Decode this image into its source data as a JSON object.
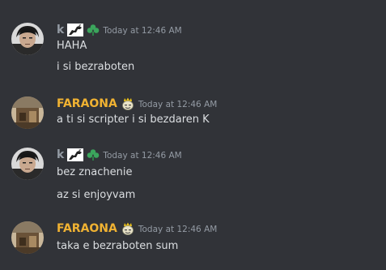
{
  "messages": [
    {
      "username": "k",
      "username_color": "#949ba4",
      "badges": [
        "horse-emblem-icon",
        "green-clover-icon"
      ],
      "timestamp": "Today at 12:46 AM",
      "lines": [
        "HAHA",
        "i si bezraboten"
      ]
    },
    {
      "username": "FARAONA",
      "username_color": "#f0b232",
      "badges": [
        "crowned-face-icon"
      ],
      "timestamp": "Today at 12:46 AM",
      "lines": [
        "a ti si scripter i si bezdaren K"
      ]
    },
    {
      "username": "k",
      "username_color": "#949ba4",
      "badges": [
        "horse-emblem-icon",
        "green-clover-icon"
      ],
      "timestamp": "Today at 12:46 AM",
      "lines": [
        "bez znachenie",
        "az si enjoyvam"
      ]
    },
    {
      "username": "FARAONA",
      "username_color": "#f0b232",
      "badges": [
        "crowned-face-icon"
      ],
      "timestamp": "Today at 12:46 AM",
      "lines": [
        "taka e bezraboten sum"
      ]
    }
  ]
}
